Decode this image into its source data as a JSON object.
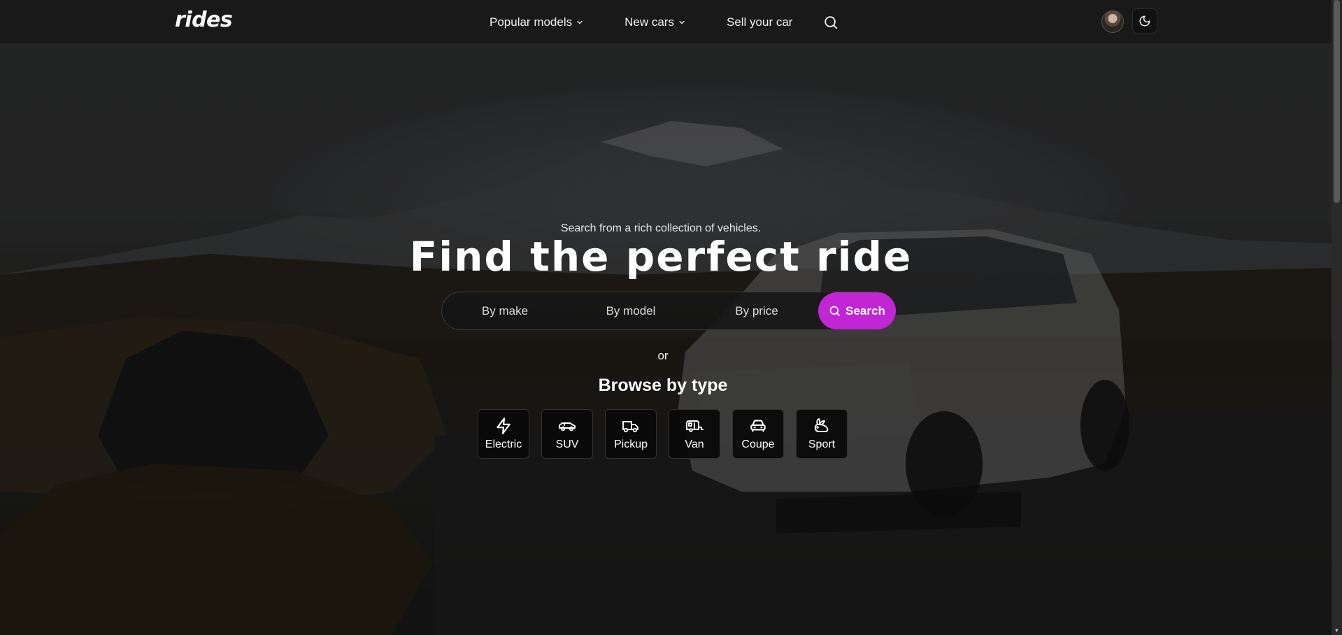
{
  "nav": {
    "logo": "rides",
    "popular_models": "Popular models",
    "new_cars": "New cars",
    "sell_your_car": "Sell your car"
  },
  "hero": {
    "subtitle": "Search from a rich collection of vehicles.",
    "title": "Find the perfect ride",
    "filters": {
      "make": "By make",
      "model": "By model",
      "price": "By price"
    },
    "search_label": "Search",
    "or_text": "or",
    "browse_title": "Browse by type",
    "types": [
      {
        "label": "Electric",
        "icon": "lightning-icon"
      },
      {
        "label": "SUV",
        "icon": "suv-icon"
      },
      {
        "label": "Pickup",
        "icon": "truck-icon"
      },
      {
        "label": "Van",
        "icon": "caravan-icon"
      },
      {
        "label": "Coupe",
        "icon": "car-front-icon"
      },
      {
        "label": "Sport",
        "icon": "rabbit-icon"
      }
    ]
  },
  "colors": {
    "accent": "#c026d3",
    "navbar": "#191919"
  }
}
